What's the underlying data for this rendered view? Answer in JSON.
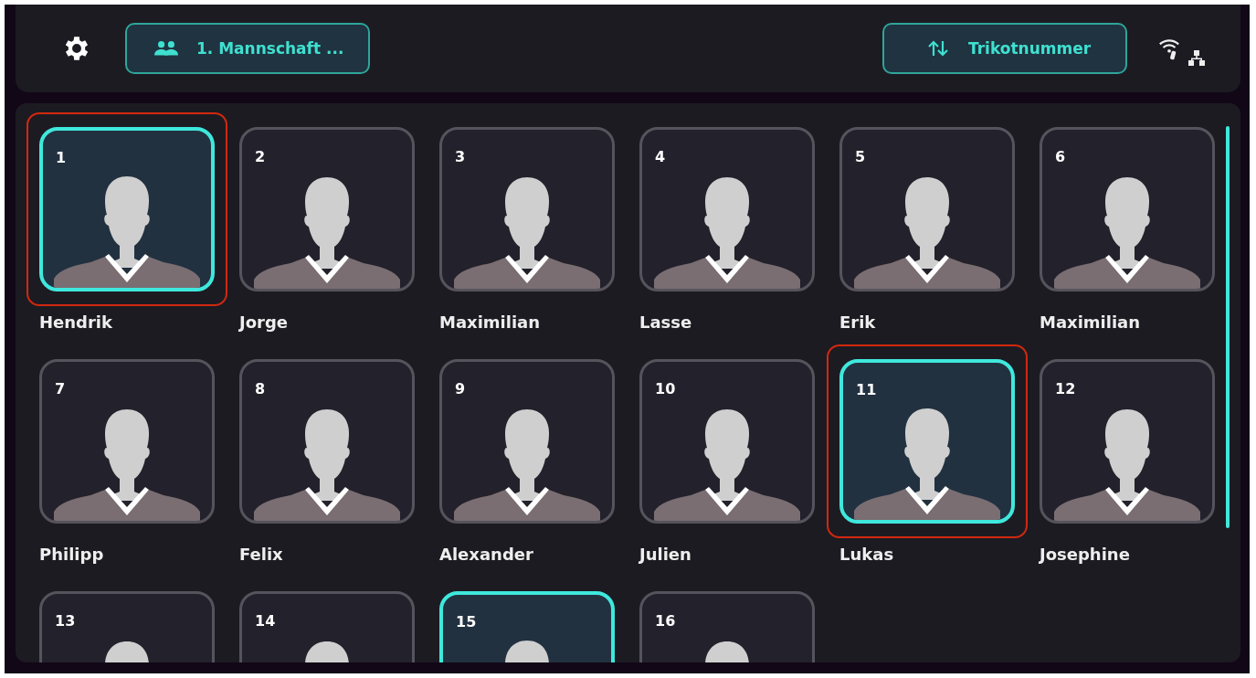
{
  "top_bar": {
    "team_button": {
      "label": "1. Mannschaft ..."
    },
    "sort_button": {
      "label": "Trikotnummer"
    }
  },
  "players": [
    {
      "number": "1",
      "name": "Hendrik",
      "selected": true,
      "highlighted": true
    },
    {
      "number": "2",
      "name": "Jorge",
      "selected": false,
      "highlighted": false
    },
    {
      "number": "3",
      "name": "Maximilian",
      "selected": false,
      "highlighted": false
    },
    {
      "number": "4",
      "name": "Lasse",
      "selected": false,
      "highlighted": false
    },
    {
      "number": "5",
      "name": "Erik",
      "selected": false,
      "highlighted": false
    },
    {
      "number": "6",
      "name": "Maximilian",
      "selected": false,
      "highlighted": false
    },
    {
      "number": "7",
      "name": "Philipp",
      "selected": false,
      "highlighted": false
    },
    {
      "number": "8",
      "name": "Felix",
      "selected": false,
      "highlighted": false
    },
    {
      "number": "9",
      "name": "Alexander",
      "selected": false,
      "highlighted": false
    },
    {
      "number": "10",
      "name": "Julien",
      "selected": false,
      "highlighted": false
    },
    {
      "number": "11",
      "name": "Lukas",
      "selected": true,
      "highlighted": true
    },
    {
      "number": "12",
      "name": "Josephine",
      "selected": false,
      "highlighted": false
    },
    {
      "number": "13",
      "selected": false,
      "highlighted": false
    },
    {
      "number": "14",
      "selected": false,
      "highlighted": false
    },
    {
      "number": "15",
      "selected": true,
      "highlighted": false
    },
    {
      "number": "16",
      "selected": false,
      "highlighted": false
    }
  ]
}
